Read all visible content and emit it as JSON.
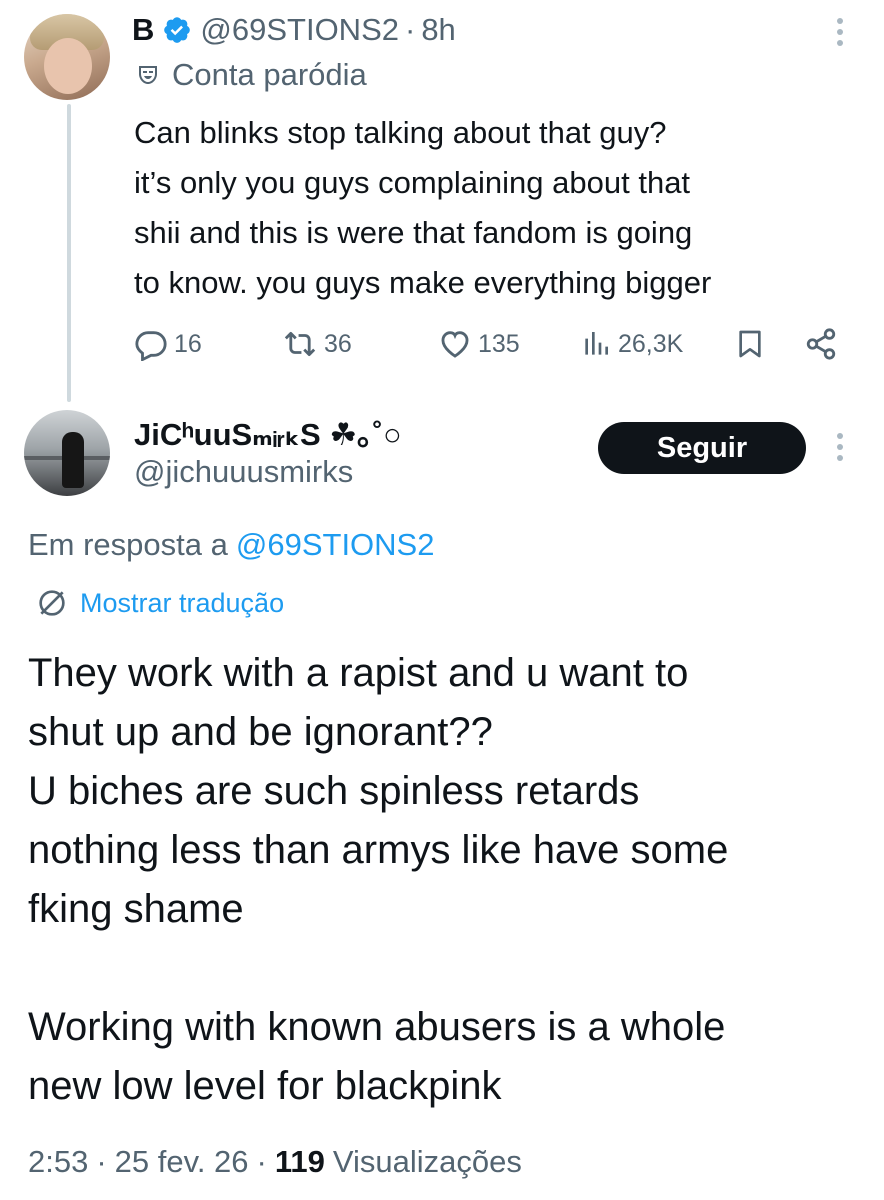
{
  "tweet1": {
    "author_name": "B",
    "handle": "@69STIONS2",
    "separator": "·",
    "time": "8h",
    "parody_label": "Conta paródia",
    "text_lines": [
      "Can blinks stop talking about that guy?",
      "it’s only you guys complaining about that",
      "shii and this is were that fandom is going",
      "to know. you guys make everything bigger"
    ],
    "stats": {
      "replies": "16",
      "retweets": "36",
      "likes": "135",
      "views": "26,3K"
    }
  },
  "tweet2": {
    "author_name": "JiCʰuuSₘᵢᵣₖS ☘︎｡˚○",
    "handle": "@jichuuusmirks",
    "follow_label": "Seguir",
    "reply_prefix": "Em resposta a",
    "reply_mention": "@69STIONS2",
    "translate_label": "Mostrar tradução",
    "paragraph1": "They work with a rapist and u want to\nshut up and be ignorant??\nU biches are such spinless retards\nnothing less than armys like have some\nfking shame",
    "paragraph2": "Working with known abusers is a whole\nnew low level for blackpink",
    "time": "2:53",
    "date": "25 fev. 26",
    "views_count": "119",
    "views_label": "Visualizações",
    "separator": "·"
  },
  "colors": {
    "text_primary": "#0f1419",
    "text_secondary": "#536471",
    "accent_blue": "#1d9bf0",
    "verified_blue": "#1d9bf0",
    "thread_line": "#cfd9de",
    "follow_button_bg": "#0f1419"
  },
  "icons": {
    "verified": "verified-badge-icon",
    "parody": "parody-mask-icon",
    "reply": "reply-bubble-icon",
    "retweet": "retweet-icon",
    "like": "heart-icon",
    "views": "views-bars-icon",
    "bookmark": "bookmark-icon",
    "share": "share-icon",
    "more": "more-dots-icon",
    "translate": "translate-globe-icon"
  }
}
